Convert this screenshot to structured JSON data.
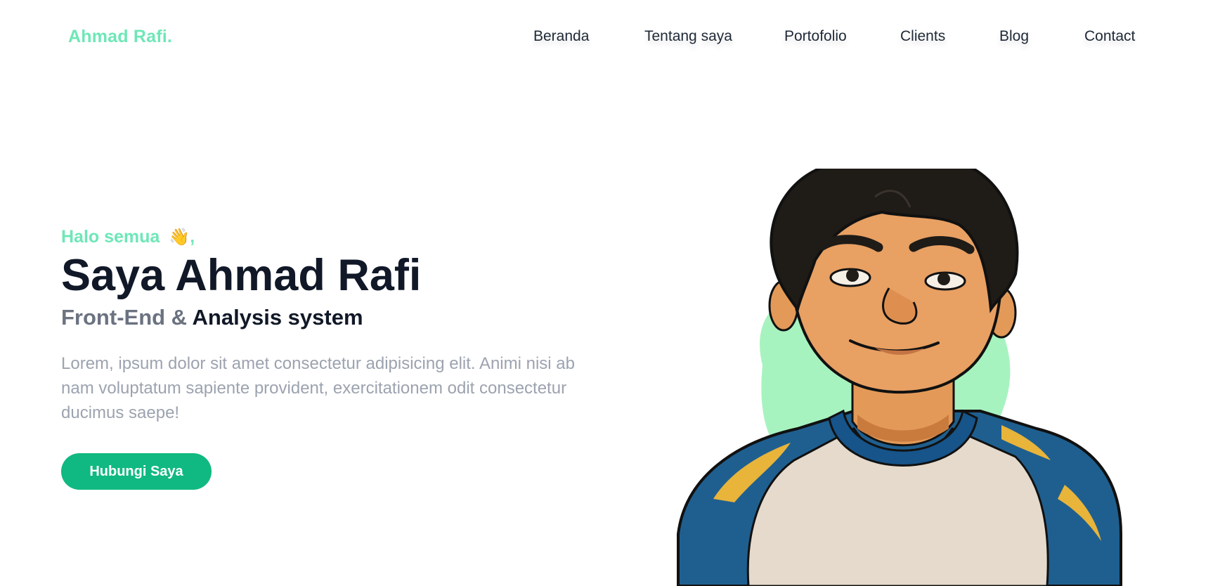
{
  "brand": {
    "name": "Ahmad Rafi.",
    "accent_color": "#6ee7b7",
    "button_color": "#10b981"
  },
  "nav": {
    "items": [
      {
        "label": "Beranda"
      },
      {
        "label": "Tentang saya"
      },
      {
        "label": "Portofolio"
      },
      {
        "label": "Clients"
      },
      {
        "label": "Blog"
      },
      {
        "label": "Contact"
      }
    ]
  },
  "hero": {
    "greeting": "Halo semua",
    "greeting_emoji": "👋",
    "greeting_suffix": ",",
    "headline": "Saya Ahmad Rafi",
    "subtitle_part1": "Front-End &",
    "subtitle_part2": "Analysis system",
    "description": "Lorem, ipsum dolor sit amet consectetur adipisicing elit. Animi nisi ab nam voluptatum sapiente provident, exercitationem odit consectetur ducimus saepe!",
    "cta_label": "Hubungi Saya",
    "illustration_icon": "cartoon-portrait"
  }
}
